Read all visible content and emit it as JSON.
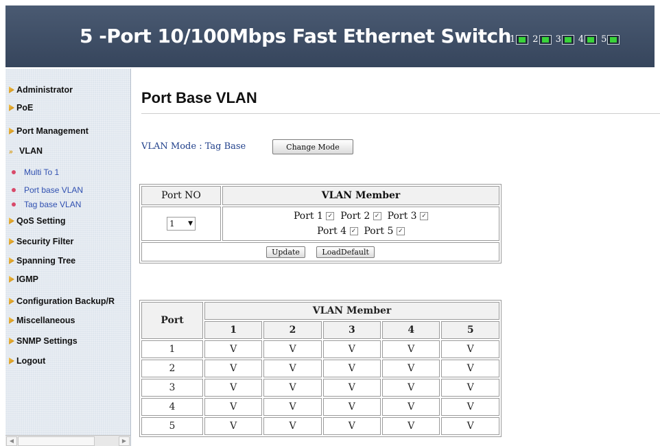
{
  "header": {
    "title": "5 -Port 10/100Mbps  Fast Ethernet Switch",
    "ports": [
      {
        "label": "1",
        "status": "green"
      },
      {
        "label": "2",
        "status": "green"
      },
      {
        "label": "3",
        "status": "green"
      },
      {
        "label": "4",
        "status": "green"
      },
      {
        "label": "5",
        "status": "green"
      }
    ]
  },
  "sidebar": {
    "items": [
      {
        "label": "Administrator"
      },
      {
        "label": "PoE"
      },
      {
        "label": "Port Management"
      },
      {
        "label": "VLAN"
      },
      {
        "label": "QoS Setting"
      },
      {
        "label": "Security Filter"
      },
      {
        "label": "Spanning Tree"
      },
      {
        "label": "IGMP"
      },
      {
        "label": "Configuration Backup/R"
      },
      {
        "label": "Miscellaneous"
      },
      {
        "label": "SNMP Settings"
      },
      {
        "label": "Logout"
      }
    ],
    "vlan_subitems": [
      {
        "label": "Multi To 1"
      },
      {
        "label": "Port base VLAN"
      },
      {
        "label": "Tag base VLAN"
      }
    ]
  },
  "main": {
    "title": "Port Base VLAN",
    "vlan_mode_label": "VLAN Mode : Tag Base",
    "change_mode_button": "Change Mode",
    "config": {
      "port_no_header": "Port NO",
      "vlan_member_header": "VLAN Member",
      "selected_port": "1",
      "members": [
        {
          "label": "Port 1",
          "checked": true
        },
        {
          "label": "Port 2",
          "checked": true
        },
        {
          "label": "Port 3",
          "checked": true
        },
        {
          "label": "Port 4",
          "checked": true
        },
        {
          "label": "Port 5",
          "checked": true
        }
      ],
      "update_button": "Update",
      "load_default_button": "LoadDefault"
    },
    "member_table": {
      "port_header": "Port",
      "vlan_member_header": "VLAN Member",
      "columns": [
        "1",
        "2",
        "3",
        "4",
        "5"
      ],
      "rows": [
        {
          "port": "1",
          "cells": [
            "V",
            "V",
            "V",
            "V",
            "V"
          ]
        },
        {
          "port": "2",
          "cells": [
            "V",
            "V",
            "V",
            "V",
            "V"
          ]
        },
        {
          "port": "3",
          "cells": [
            "V",
            "V",
            "V",
            "V",
            "V"
          ]
        },
        {
          "port": "4",
          "cells": [
            "V",
            "V",
            "V",
            "V",
            "V"
          ]
        },
        {
          "port": "5",
          "cells": [
            "V",
            "V",
            "V",
            "V",
            "V"
          ]
        }
      ]
    }
  }
}
